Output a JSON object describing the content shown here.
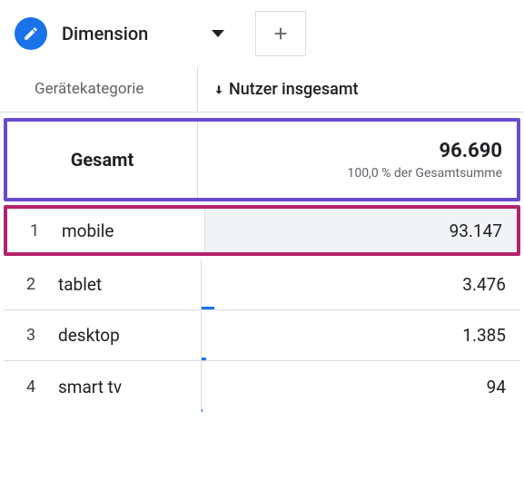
{
  "header": {
    "dimension_label": "Dimension"
  },
  "columns": {
    "category_header": "Gerätekategorie",
    "metric_header": "Nutzer insgesamt"
  },
  "totals": {
    "label": "Gesamt",
    "value": "96.690",
    "subtext": "100,0 % der Gesamtsumme"
  },
  "rows": [
    {
      "index": "1",
      "category": "mobile",
      "value": "93.147",
      "bar_pct": 100
    },
    {
      "index": "2",
      "category": "tablet",
      "value": "3.476",
      "bar_pct": 4
    },
    {
      "index": "3",
      "category": "desktop",
      "value": "1.385",
      "bar_pct": 1.5
    },
    {
      "index": "4",
      "category": "smart tv",
      "value": "94",
      "bar_pct": 0.2
    }
  ]
}
